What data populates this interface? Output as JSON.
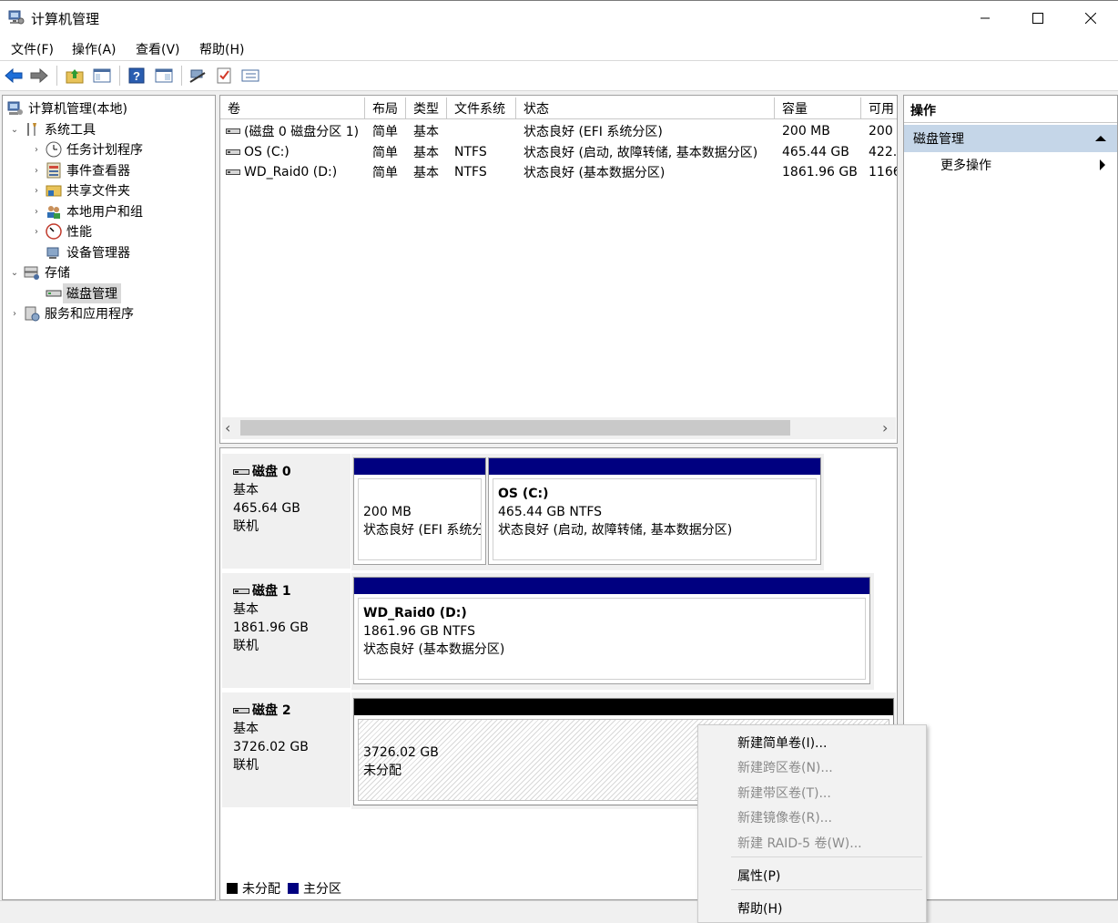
{
  "window": {
    "title": "计算机管理",
    "minimize": "—",
    "maximize": "☐",
    "close": "✕"
  },
  "menu": [
    "文件(F)",
    "操作(A)",
    "查看(V)",
    "帮助(H)"
  ],
  "toolbar": {
    "icons": [
      "back-arrow-icon",
      "forward-arrow-icon",
      "up-folder-icon",
      "show-hide-tree-icon",
      "help-icon",
      "properties-icon",
      "connect-icon",
      "check-icon",
      "list-view-icon"
    ]
  },
  "tree": {
    "root": "计算机管理(本地)",
    "system_tools": "系统工具",
    "task_scheduler": "任务计划程序",
    "event_viewer": "事件查看器",
    "shared_folders": "共享文件夹",
    "local_users": "本地用户和组",
    "performance": "性能",
    "device_manager": "设备管理器",
    "storage": "存储",
    "disk_management": "磁盘管理",
    "services": "服务和应用程序"
  },
  "volumes": {
    "headers": [
      "卷",
      "布局",
      "类型",
      "文件系统",
      "状态",
      "容量",
      "可用"
    ],
    "rows": [
      [
        "(磁盘 0 磁盘分区 1)",
        "简单",
        "基本",
        "",
        "状态良好 (EFI 系统分区)",
        "200 MB",
        "200"
      ],
      [
        "OS (C:)",
        "简单",
        "基本",
        "NTFS",
        "状态良好 (启动, 故障转储, 基本数据分区)",
        "465.44 GB",
        "422."
      ],
      [
        "WD_Raid0 (D:)",
        "简单",
        "基本",
        "NTFS",
        "状态良好 (基本数据分区)",
        "1861.96 GB",
        "1166"
      ]
    ]
  },
  "scroll": {
    "left": "‹",
    "right": "›"
  },
  "disks": [
    {
      "name": "磁盘 0",
      "type": "基本",
      "size": "465.64 GB",
      "status": "联机",
      "parts": [
        {
          "title": "",
          "size": "200 MB",
          "status": "状态良好 (EFI 系统分区)"
        },
        {
          "title": "OS  (C:)",
          "size": "465.44 GB NTFS",
          "status": "状态良好 (启动, 故障转储, 基本数据分区)"
        }
      ]
    },
    {
      "name": "磁盘 1",
      "type": "基本",
      "size": "1861.96 GB",
      "status": "联机",
      "parts": [
        {
          "title": "WD_Raid0  (D:)",
          "size": "1861.96 GB NTFS",
          "status": "状态良好 (基本数据分区)"
        }
      ]
    },
    {
      "name": "磁盘 2",
      "type": "基本",
      "size": "3726.02 GB",
      "status": "联机",
      "parts": [
        {
          "title": "",
          "size": "3726.02 GB",
          "status": "未分配"
        }
      ]
    }
  ],
  "legend": {
    "unallocated": "未分配",
    "primary": "主分区"
  },
  "actions": {
    "header": "操作",
    "selected": "磁盘管理",
    "more": "更多操作"
  },
  "context_menu": {
    "new_simple": "新建简单卷(I)...",
    "new_spanned": "新建跨区卷(N)...",
    "new_striped": "新建带区卷(T)...",
    "new_mirrored": "新建镜像卷(R)...",
    "new_raid5": "新建 RAID-5 卷(W)...",
    "properties": "属性(P)",
    "help": "帮助(H)"
  },
  "colors": {
    "primary_partition": "#000080",
    "unallocated": "#000000",
    "selection": "#c5d6e8"
  }
}
